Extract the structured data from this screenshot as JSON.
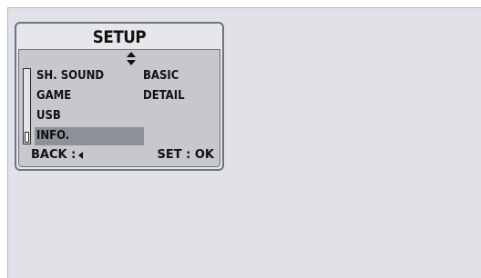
{
  "screen": {
    "title": "SETUP",
    "menu_left": [
      "SH. SOUND",
      "GAME",
      "USB",
      "INFO."
    ],
    "menu_right": [
      "BASIC",
      "DETAIL"
    ],
    "selected_item": "INFO.",
    "footer_back": "BACK :",
    "footer_set": "SET : OK"
  },
  "icons": {
    "navigation": "up-down-arrows-icon",
    "back": "left-arrow-icon"
  },
  "colors": {
    "background": "#e1e2e7",
    "lcd_panel": "#c6c8ce",
    "selection": "#8d9099",
    "frame": "#6f737d",
    "accent_line": "#8fc3e6"
  }
}
